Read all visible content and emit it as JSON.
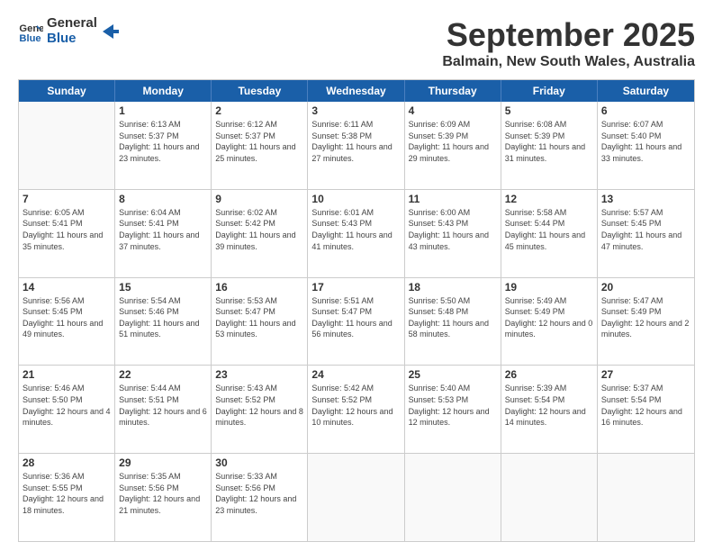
{
  "logo": {
    "line1": "General",
    "line2": "Blue"
  },
  "title": "September 2025",
  "location": "Balmain, New South Wales, Australia",
  "weekdays": [
    "Sunday",
    "Monday",
    "Tuesday",
    "Wednesday",
    "Thursday",
    "Friday",
    "Saturday"
  ],
  "weeks": [
    [
      {
        "day": "",
        "empty": true
      },
      {
        "day": "1",
        "sunrise": "6:13 AM",
        "sunset": "5:37 PM",
        "daylight": "11 hours and 23 minutes."
      },
      {
        "day": "2",
        "sunrise": "6:12 AM",
        "sunset": "5:37 PM",
        "daylight": "11 hours and 25 minutes."
      },
      {
        "day": "3",
        "sunrise": "6:11 AM",
        "sunset": "5:38 PM",
        "daylight": "11 hours and 27 minutes."
      },
      {
        "day": "4",
        "sunrise": "6:09 AM",
        "sunset": "5:39 PM",
        "daylight": "11 hours and 29 minutes."
      },
      {
        "day": "5",
        "sunrise": "6:08 AM",
        "sunset": "5:39 PM",
        "daylight": "11 hours and 31 minutes."
      },
      {
        "day": "6",
        "sunrise": "6:07 AM",
        "sunset": "5:40 PM",
        "daylight": "11 hours and 33 minutes."
      }
    ],
    [
      {
        "day": "7",
        "sunrise": "6:05 AM",
        "sunset": "5:41 PM",
        "daylight": "11 hours and 35 minutes."
      },
      {
        "day": "8",
        "sunrise": "6:04 AM",
        "sunset": "5:41 PM",
        "daylight": "11 hours and 37 minutes."
      },
      {
        "day": "9",
        "sunrise": "6:02 AM",
        "sunset": "5:42 PM",
        "daylight": "11 hours and 39 minutes."
      },
      {
        "day": "10",
        "sunrise": "6:01 AM",
        "sunset": "5:43 PM",
        "daylight": "11 hours and 41 minutes."
      },
      {
        "day": "11",
        "sunrise": "6:00 AM",
        "sunset": "5:43 PM",
        "daylight": "11 hours and 43 minutes."
      },
      {
        "day": "12",
        "sunrise": "5:58 AM",
        "sunset": "5:44 PM",
        "daylight": "11 hours and 45 minutes."
      },
      {
        "day": "13",
        "sunrise": "5:57 AM",
        "sunset": "5:45 PM",
        "daylight": "11 hours and 47 minutes."
      }
    ],
    [
      {
        "day": "14",
        "sunrise": "5:56 AM",
        "sunset": "5:45 PM",
        "daylight": "11 hours and 49 minutes."
      },
      {
        "day": "15",
        "sunrise": "5:54 AM",
        "sunset": "5:46 PM",
        "daylight": "11 hours and 51 minutes."
      },
      {
        "day": "16",
        "sunrise": "5:53 AM",
        "sunset": "5:47 PM",
        "daylight": "11 hours and 53 minutes."
      },
      {
        "day": "17",
        "sunrise": "5:51 AM",
        "sunset": "5:47 PM",
        "daylight": "11 hours and 56 minutes."
      },
      {
        "day": "18",
        "sunrise": "5:50 AM",
        "sunset": "5:48 PM",
        "daylight": "11 hours and 58 minutes."
      },
      {
        "day": "19",
        "sunrise": "5:49 AM",
        "sunset": "5:49 PM",
        "daylight": "12 hours and 0 minutes."
      },
      {
        "day": "20",
        "sunrise": "5:47 AM",
        "sunset": "5:49 PM",
        "daylight": "12 hours and 2 minutes."
      }
    ],
    [
      {
        "day": "21",
        "sunrise": "5:46 AM",
        "sunset": "5:50 PM",
        "daylight": "12 hours and 4 minutes."
      },
      {
        "day": "22",
        "sunrise": "5:44 AM",
        "sunset": "5:51 PM",
        "daylight": "12 hours and 6 minutes."
      },
      {
        "day": "23",
        "sunrise": "5:43 AM",
        "sunset": "5:52 PM",
        "daylight": "12 hours and 8 minutes."
      },
      {
        "day": "24",
        "sunrise": "5:42 AM",
        "sunset": "5:52 PM",
        "daylight": "12 hours and 10 minutes."
      },
      {
        "day": "25",
        "sunrise": "5:40 AM",
        "sunset": "5:53 PM",
        "daylight": "12 hours and 12 minutes."
      },
      {
        "day": "26",
        "sunrise": "5:39 AM",
        "sunset": "5:54 PM",
        "daylight": "12 hours and 14 minutes."
      },
      {
        "day": "27",
        "sunrise": "5:37 AM",
        "sunset": "5:54 PM",
        "daylight": "12 hours and 16 minutes."
      }
    ],
    [
      {
        "day": "28",
        "sunrise": "5:36 AM",
        "sunset": "5:55 PM",
        "daylight": "12 hours and 18 minutes."
      },
      {
        "day": "29",
        "sunrise": "5:35 AM",
        "sunset": "5:56 PM",
        "daylight": "12 hours and 21 minutes."
      },
      {
        "day": "30",
        "sunrise": "5:33 AM",
        "sunset": "5:56 PM",
        "daylight": "12 hours and 23 minutes."
      },
      {
        "day": "",
        "empty": true
      },
      {
        "day": "",
        "empty": true
      },
      {
        "day": "",
        "empty": true
      },
      {
        "day": "",
        "empty": true
      }
    ]
  ]
}
